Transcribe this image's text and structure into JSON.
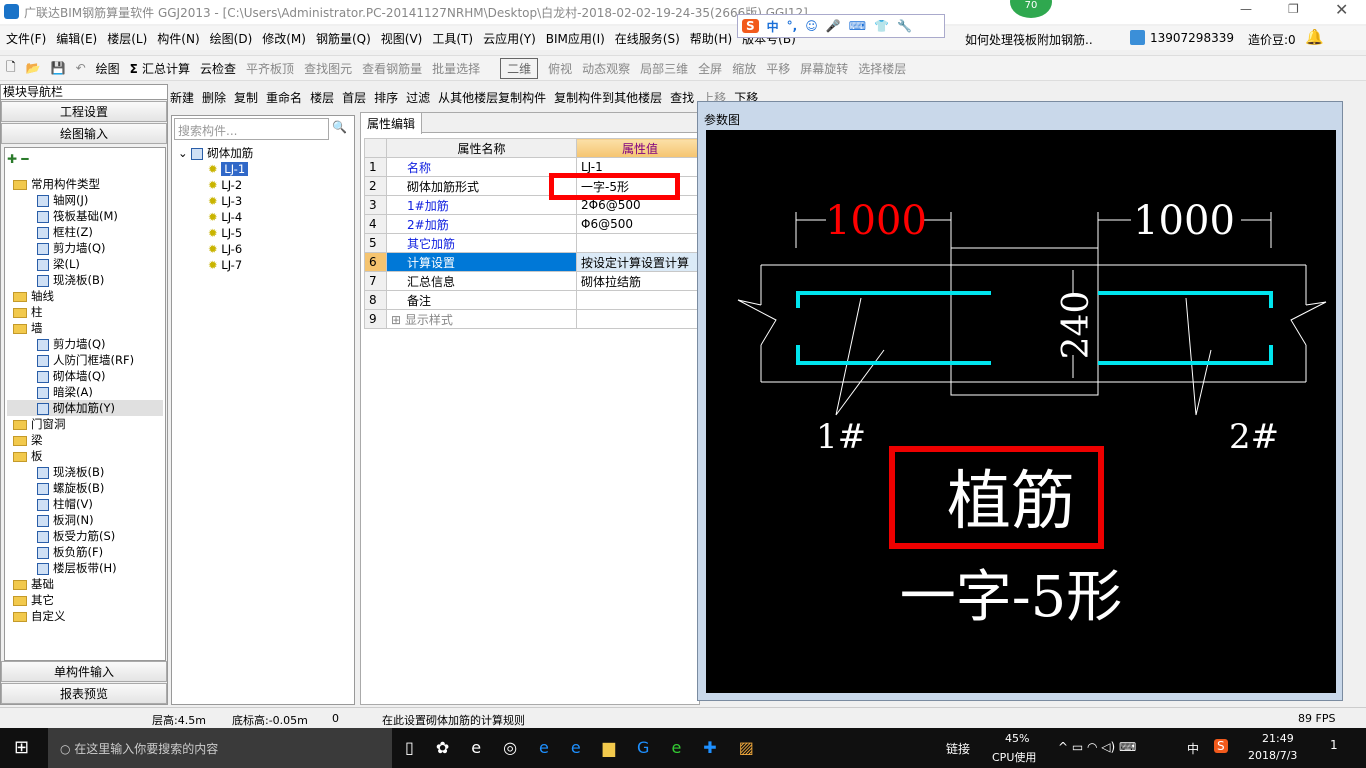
{
  "window": {
    "title": "广联达BIM钢筋算量软件 GGJ2013 - [C:\\Users\\Administrator.PC-20141127NRHM\\Desktop\\白龙村-2018-02-02-19-24-35(2666版).GGJ12]",
    "badge": "70"
  },
  "menu": [
    "文件(F)",
    "编辑(E)",
    "楼层(L)",
    "构件(N)",
    "绘图(D)",
    "修改(M)",
    "钢筋量(Q)",
    "视图(V)",
    "工具(T)",
    "云应用(Y)",
    "BIM应用(I)",
    "在线服务(S)",
    "帮助(H)",
    "版本号(B)"
  ],
  "menu_right": {
    "tip": "如何处理筏板附加钢筋..",
    "user": "13907298339",
    "beans": "造价豆:0"
  },
  "toolbar": [
    "绘图",
    "汇总计算",
    "云检查",
    "平齐板顶",
    "查找图元",
    "查看钢筋量",
    "批量选择",
    "二维",
    "俯视",
    "动态观察",
    "局部三维",
    "全屏",
    "缩放",
    "平移",
    "屏幕旋转",
    "选择楼层"
  ],
  "nav": {
    "title": "模块导航栏",
    "btn_project": "工程设置",
    "btn_draw": "绘图输入",
    "btn_single": "单构件输入",
    "btn_report": "报表预览",
    "tree": [
      {
        "l": 0,
        "t": "常用构件类型",
        "f": 1
      },
      {
        "l": 1,
        "t": "轴网(J)"
      },
      {
        "l": 1,
        "t": "筏板基础(M)"
      },
      {
        "l": 1,
        "t": "框柱(Z)"
      },
      {
        "l": 1,
        "t": "剪力墙(Q)"
      },
      {
        "l": 1,
        "t": "梁(L)"
      },
      {
        "l": 1,
        "t": "现浇板(B)"
      },
      {
        "l": 0,
        "t": "轴线",
        "f": 1
      },
      {
        "l": 0,
        "t": "柱",
        "f": 1
      },
      {
        "l": 0,
        "t": "墙",
        "f": 1
      },
      {
        "l": 1,
        "t": "剪力墙(Q)"
      },
      {
        "l": 1,
        "t": "人防门框墙(RF)"
      },
      {
        "l": 1,
        "t": "砌体墙(Q)"
      },
      {
        "l": 1,
        "t": "暗梁(A)"
      },
      {
        "l": 1,
        "t": "砌体加筋(Y)",
        "sel": 1
      },
      {
        "l": 0,
        "t": "门窗洞",
        "f": 1
      },
      {
        "l": 0,
        "t": "梁",
        "f": 1
      },
      {
        "l": 0,
        "t": "板",
        "f": 1
      },
      {
        "l": 1,
        "t": "现浇板(B)"
      },
      {
        "l": 1,
        "t": "螺旋板(B)"
      },
      {
        "l": 1,
        "t": "柱帽(V)"
      },
      {
        "l": 1,
        "t": "板洞(N)"
      },
      {
        "l": 1,
        "t": "板受力筋(S)"
      },
      {
        "l": 1,
        "t": "板负筋(F)"
      },
      {
        "l": 1,
        "t": "楼层板带(H)"
      },
      {
        "l": 0,
        "t": "基础",
        "f": 1
      },
      {
        "l": 0,
        "t": "其它",
        "f": 1
      },
      {
        "l": 0,
        "t": "自定义",
        "f": 1
      }
    ]
  },
  "toolbar2": {
    "new": "新建",
    "delete": "删除",
    "copy": "复制",
    "rename": "重命名",
    "floor_label": "楼层",
    "floor": "首层",
    "sort": "排序",
    "filter": "过滤",
    "copy_from": "从其他楼层复制构件",
    "copy_to": "复制构件到其他楼层",
    "find": "查找",
    "up": "上移",
    "down": "下移"
  },
  "complist": {
    "search_placeholder": "搜索构件...",
    "root": "砌体加筋",
    "items": [
      "LJ-1",
      "LJ-2",
      "LJ-3",
      "LJ-4",
      "LJ-5",
      "LJ-6",
      "LJ-7"
    ]
  },
  "props": {
    "tab": "属性编辑",
    "col_name": "属性名称",
    "col_value": "属性值",
    "rows": [
      {
        "n": "1",
        "k": "名称",
        "v": "LJ-1",
        "blue": 1
      },
      {
        "n": "2",
        "k": "砌体加筋形式",
        "v": "一字-5形"
      },
      {
        "n": "3",
        "k": "1#加筋",
        "v": "2Φ6@500",
        "blue": 1
      },
      {
        "n": "4",
        "k": "2#加筋",
        "v": "Φ6@500",
        "blue": 1
      },
      {
        "n": "5",
        "k": "其它加筋",
        "v": "",
        "blue": 1
      },
      {
        "n": "6",
        "k": "计算设置",
        "v": "按设定计算设置计算",
        "sel": 1
      },
      {
        "n": "7",
        "k": "汇总信息",
        "v": "砌体拉结筋"
      },
      {
        "n": "8",
        "k": "备注",
        "v": ""
      },
      {
        "n": "9",
        "k": "显示样式",
        "v": "",
        "exp": 1
      }
    ]
  },
  "dialog": {
    "title": "参数图",
    "dim_left": "1000",
    "dim_right": "1000",
    "dim_thick": "240",
    "label1": "1#",
    "label2": "2#",
    "name": "植筋",
    "shape": "一字-5形"
  },
  "status": {
    "floor_h": "层高:4.5m",
    "base_h": "底标高:-0.05m",
    "count": "0",
    "msg": "在此设置砌体加筋的计算规则",
    "fps": "89 FPS"
  },
  "taskbar": {
    "search": "在这里输入你要搜索的内容",
    "link": "链接",
    "cpu": "45%",
    "cpu_label": "CPU使用",
    "ime": "中",
    "time": "21:49",
    "date": "2018/7/3",
    "notif": "1"
  },
  "colors": {
    "cyan": "#00e5ee",
    "red": "#ff0000",
    "select": "#0078d7"
  }
}
